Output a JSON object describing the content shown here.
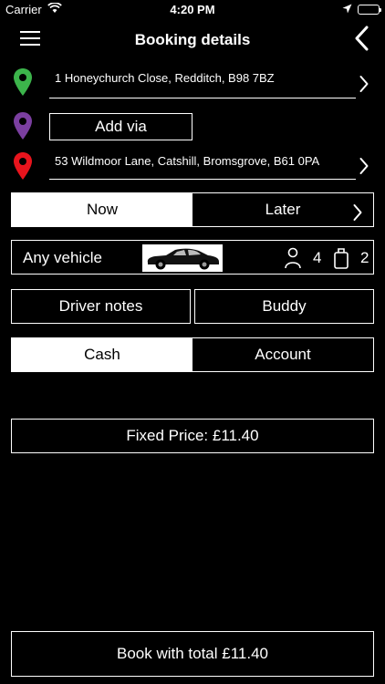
{
  "status": {
    "carrier": "Carrier",
    "time": "4:20 PM"
  },
  "nav": {
    "title": "Booking details"
  },
  "pickup": {
    "address": "1 Honeychurch Close, Redditch, B98 7BZ",
    "pin_color": "#3cb44b"
  },
  "via": {
    "label": "Add via",
    "pin_color": "#7b3fa0"
  },
  "dropoff": {
    "address": "53 Wildmoor Lane, Catshill, Bromsgrove, B61 0PA",
    "pin_color": "#e8141d"
  },
  "timing": {
    "now": "Now",
    "later": "Later",
    "selected": "now"
  },
  "vehicle": {
    "label": "Any vehicle",
    "passengers": "4",
    "bags": "2"
  },
  "options": {
    "driver_notes": "Driver notes",
    "buddy": "Buddy"
  },
  "payment": {
    "cash": "Cash",
    "account": "Account",
    "selected": "cash"
  },
  "price": {
    "label": "Fixed Price: £11.40"
  },
  "book": {
    "label": "Book with total £11.40"
  }
}
